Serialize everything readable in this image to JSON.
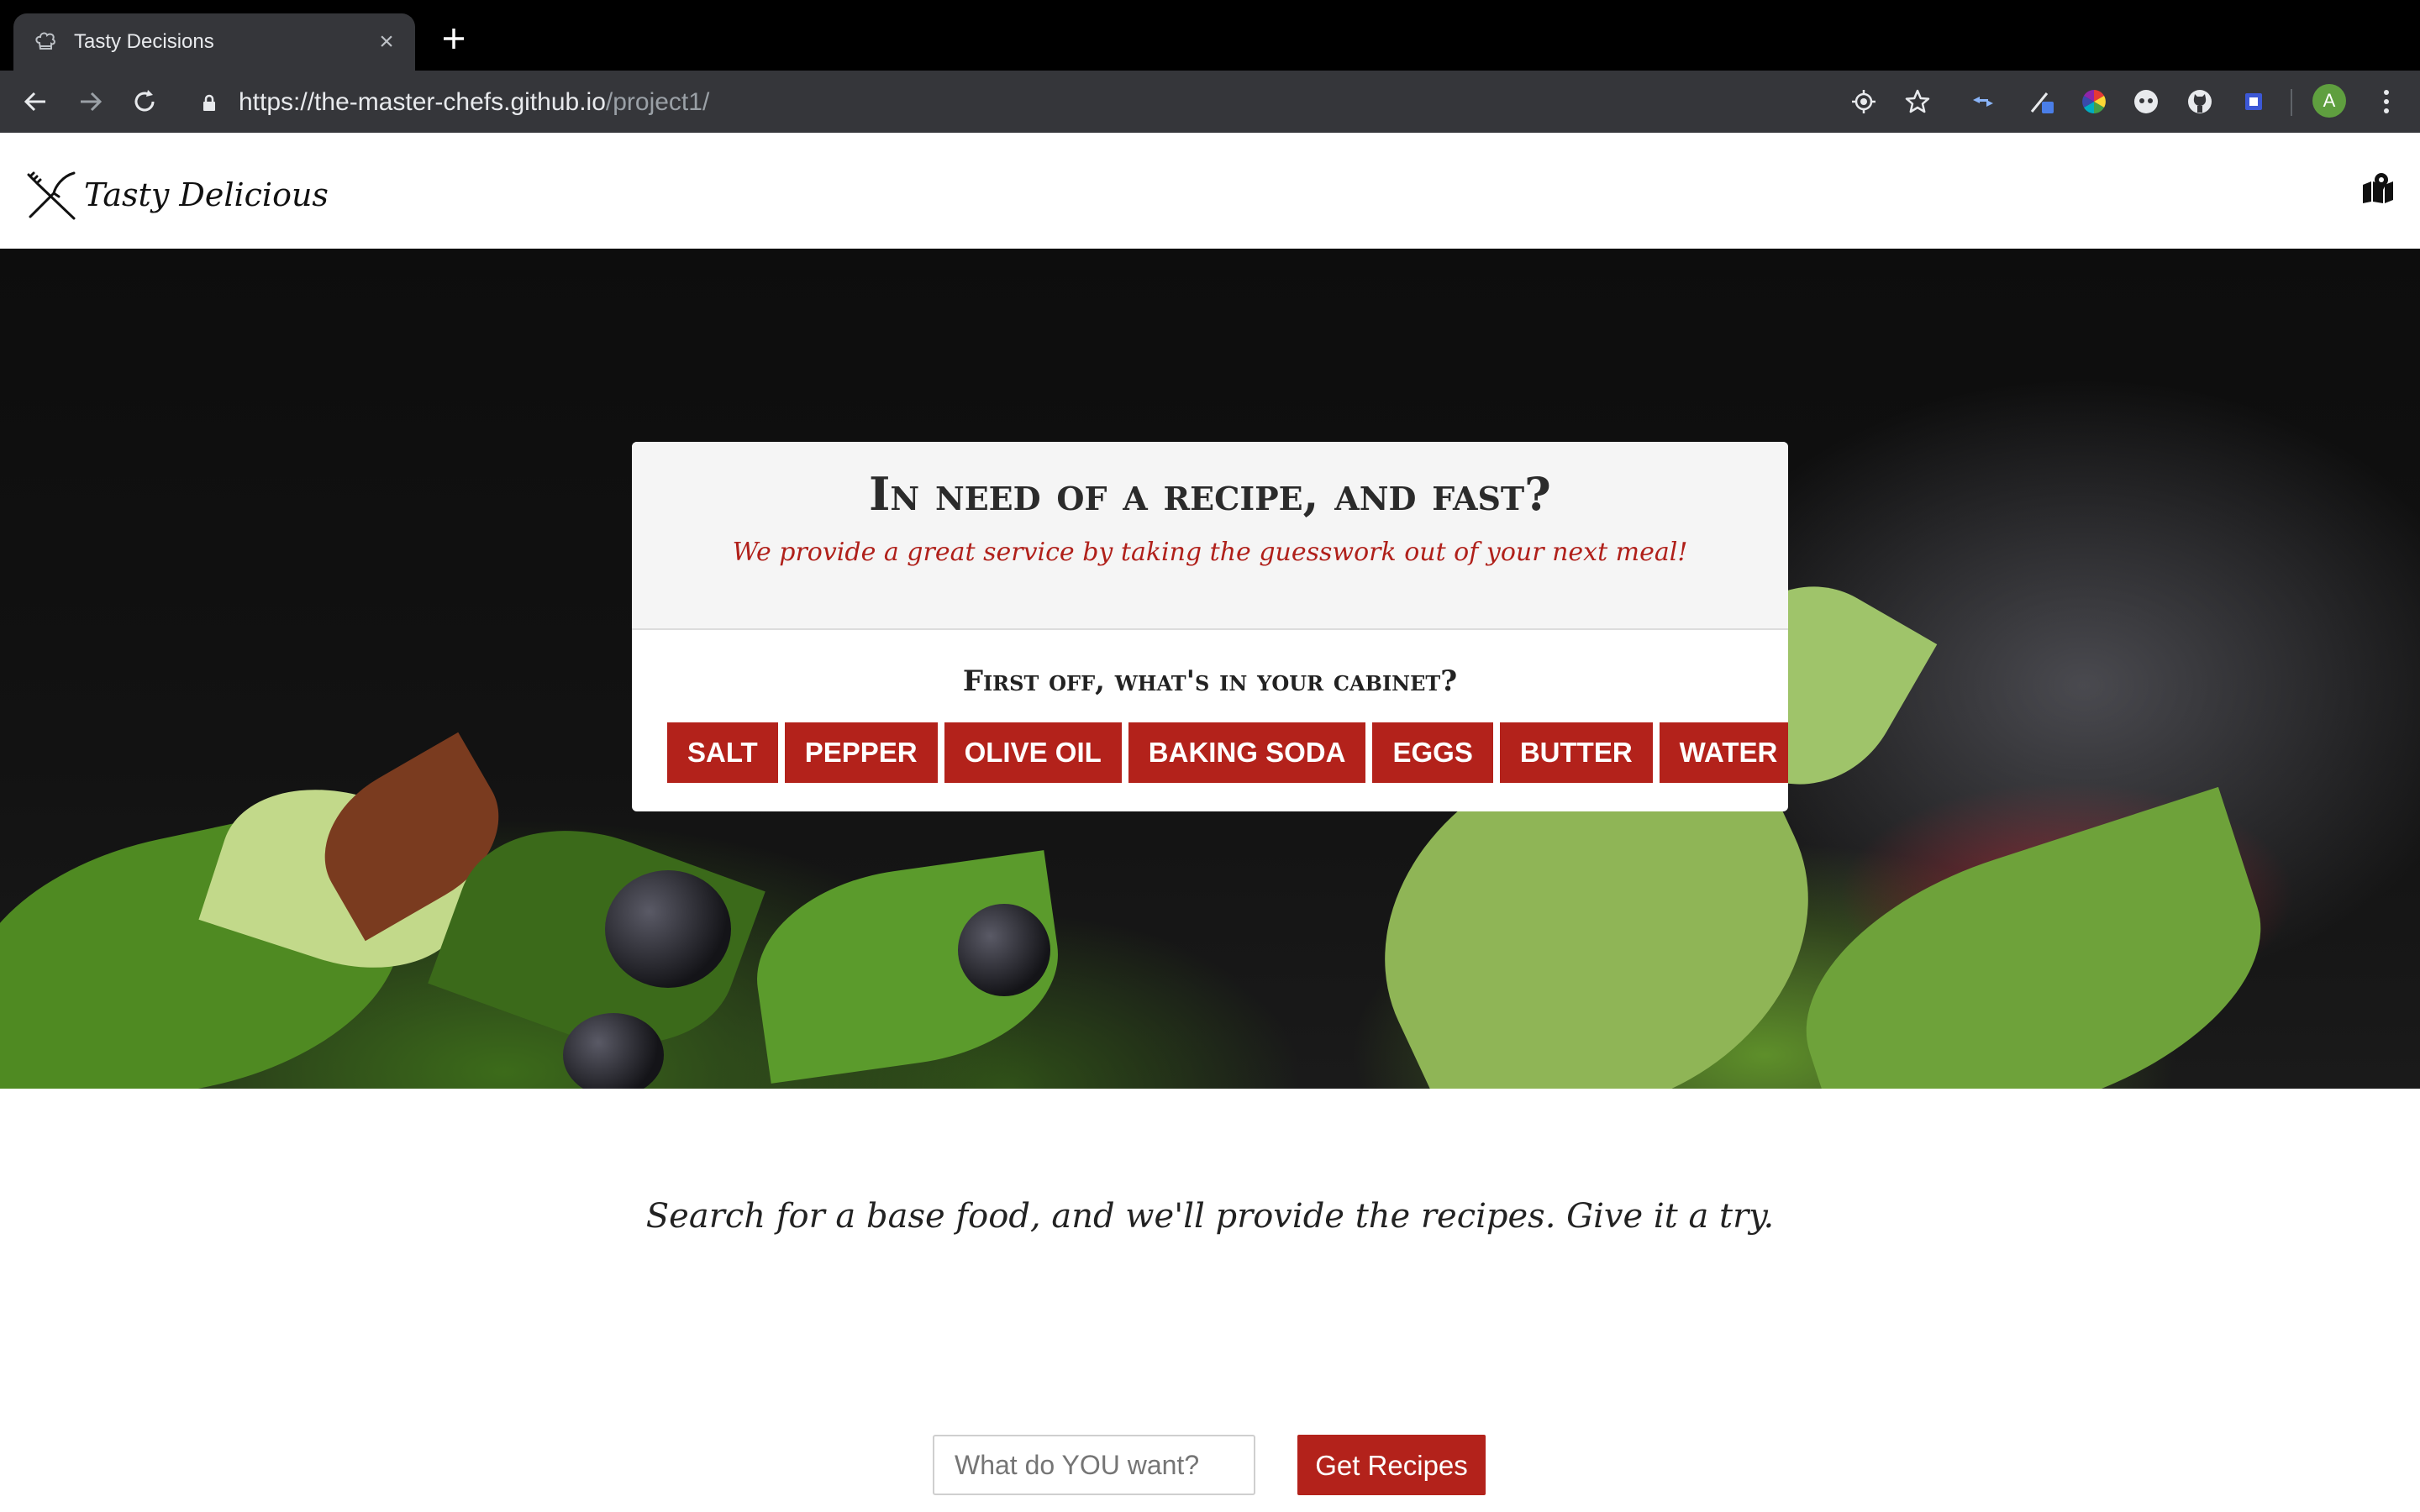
{
  "browser": {
    "tab_title": "Tasty Decisions",
    "tab_close": "×",
    "url_main": "https://the-master-chefs.github.io",
    "url_path": "/project1/",
    "avatar_letter": "A",
    "icons": [
      "back-icon",
      "forward-icon",
      "reload-icon",
      "lock-icon",
      "location-icon",
      "star-icon",
      "extension-icons",
      "menu-icon"
    ]
  },
  "site": {
    "brand": "Tasty Delicious",
    "map_icon": "map-marker-icon"
  },
  "hero": {
    "title": "In need of a recipe, and fast?",
    "subtitle": "We provide a great service by taking the guesswork out of your next meal!",
    "cabinet_question": "First off, what's in your cabinet?",
    "ingredients": [
      "SALT",
      "PEPPER",
      "OLIVE OIL",
      "BAKING SODA",
      "EGGS",
      "BUTTER",
      "WATER"
    ]
  },
  "search": {
    "tagline": "Search for a base food, and we'll provide the recipes. Give it a try.",
    "placeholder": "What do YOU want?",
    "button": "Get Recipes"
  },
  "colors": {
    "accent_red": "#b3221b",
    "chrome_dark": "#35363a"
  }
}
